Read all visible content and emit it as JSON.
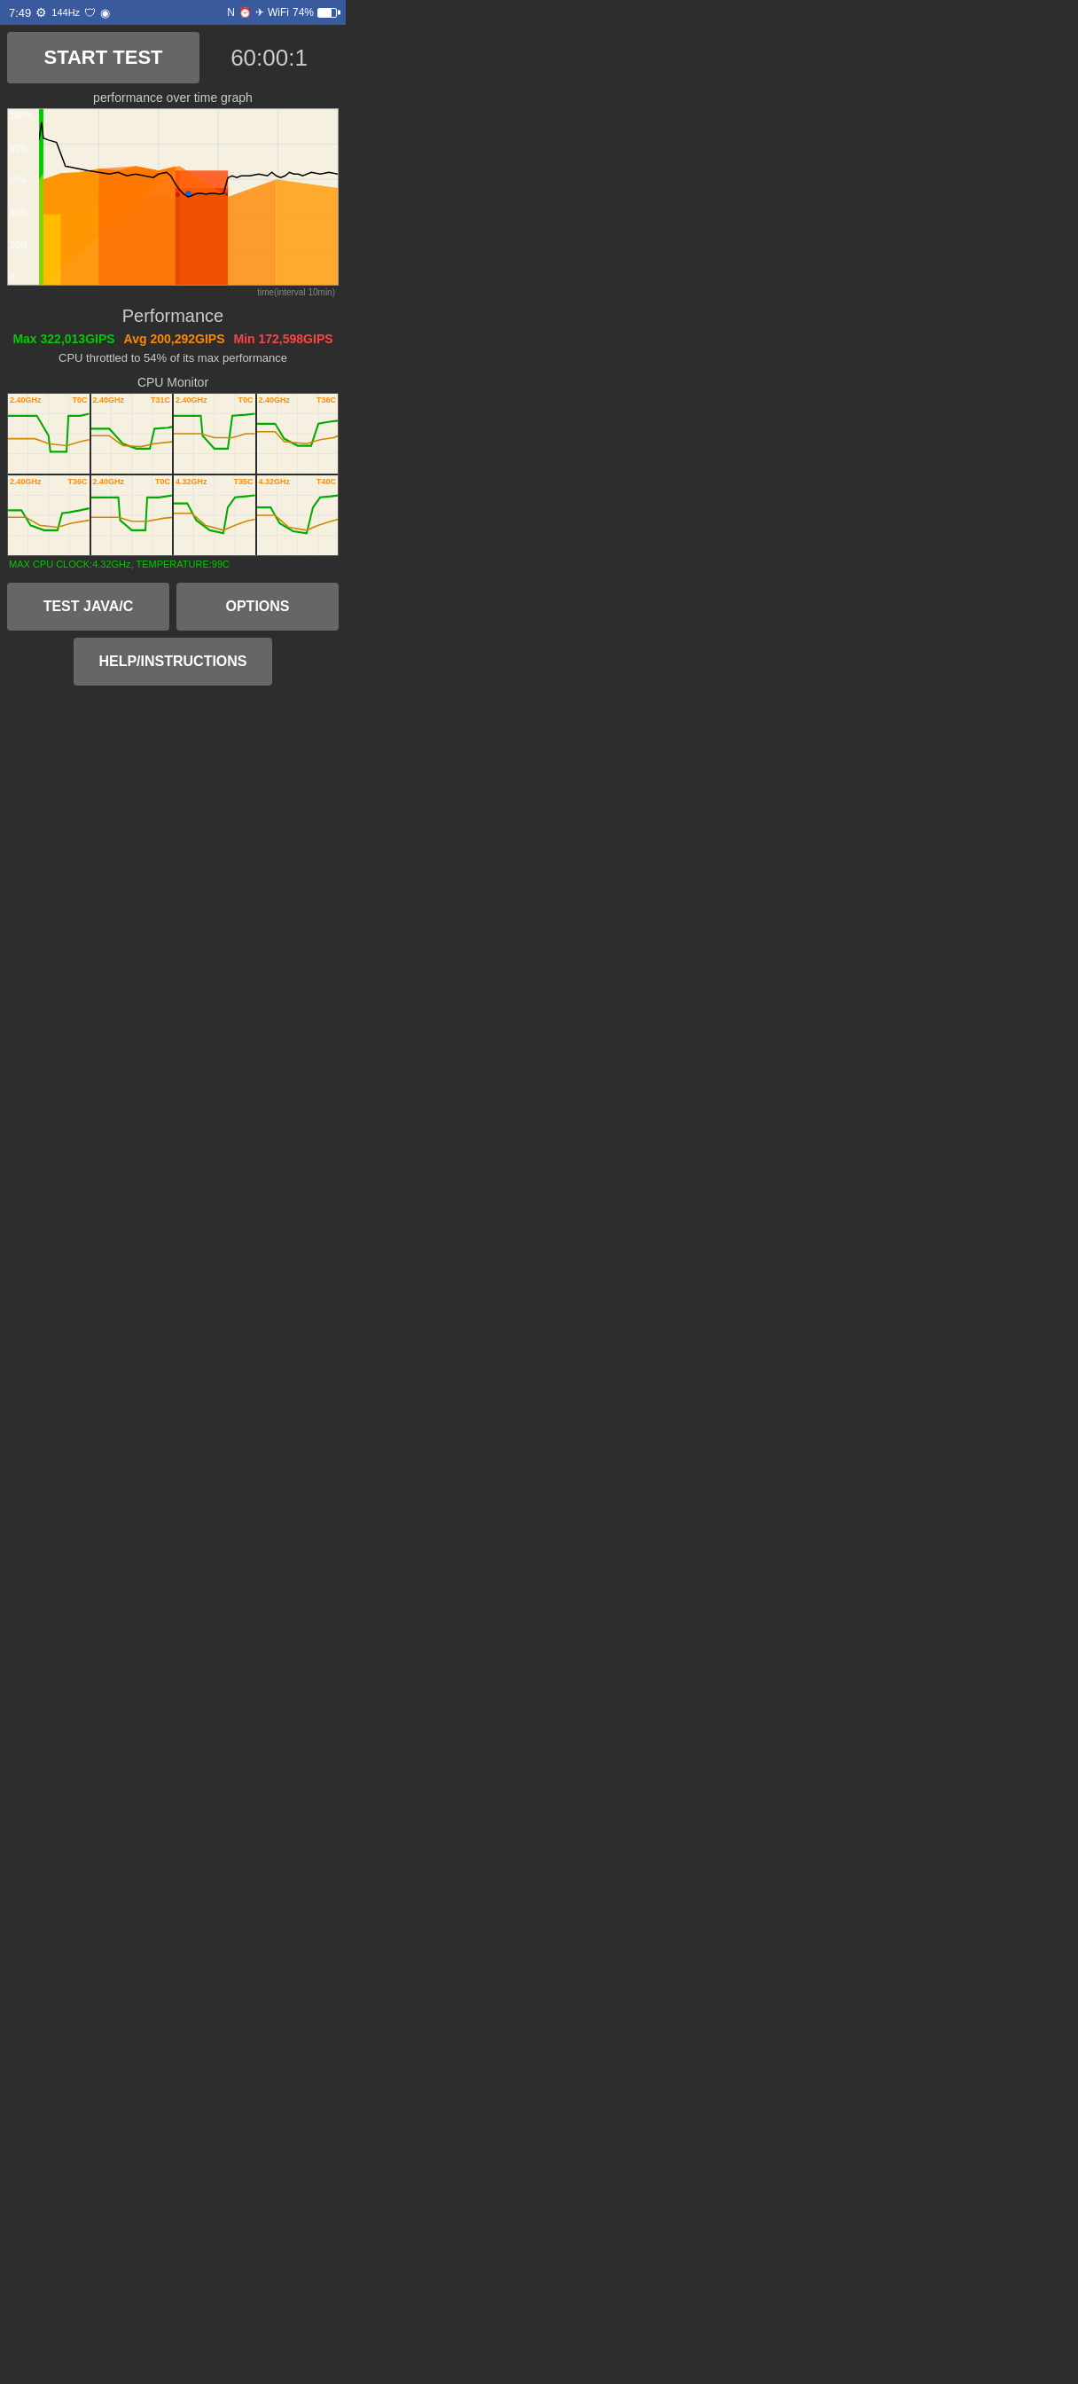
{
  "statusBar": {
    "time": "7:49",
    "batteryPercent": "74%",
    "refreshRate": "144Hz"
  },
  "topControls": {
    "startButtonLabel": "START TEST",
    "timerValue": "60:00:1"
  },
  "graph": {
    "title": "performance over time graph",
    "yLabels": [
      "100%",
      "80%",
      "60%",
      "40%",
      "20%",
      "0"
    ],
    "xLabel": "time(interval 10min)"
  },
  "performance": {
    "title": "Performance",
    "max": "Max 322,013GIPS",
    "avg": "Avg 200,292GIPS",
    "min": "Min 172,598GIPS",
    "note": "CPU throttled to 54% of its max performance"
  },
  "cpuMonitor": {
    "title": "CPU Monitor",
    "cells": [
      {
        "freq": "2.40GHz",
        "temp": "T0C"
      },
      {
        "freq": "2.40GHz",
        "temp": "T31C"
      },
      {
        "freq": "2.40GHz",
        "temp": "T0C"
      },
      {
        "freq": "2.40GHz",
        "temp": "T36C"
      },
      {
        "freq": "2.40GHz",
        "temp": "T36C"
      },
      {
        "freq": "2.40GHz",
        "temp": "T0C"
      },
      {
        "freq": "4.32GHz",
        "temp": "T35C"
      },
      {
        "freq": "4.32GHz",
        "temp": "T40C"
      }
    ],
    "maxInfo": "MAX CPU CLOCK:4.32GHz, TEMPERATURE:99C"
  },
  "buttons": {
    "testJavaC": "TEST JAVA/C",
    "options": "OPTIONS",
    "helpInstructions": "HELP/INSTRUCTIONS"
  }
}
